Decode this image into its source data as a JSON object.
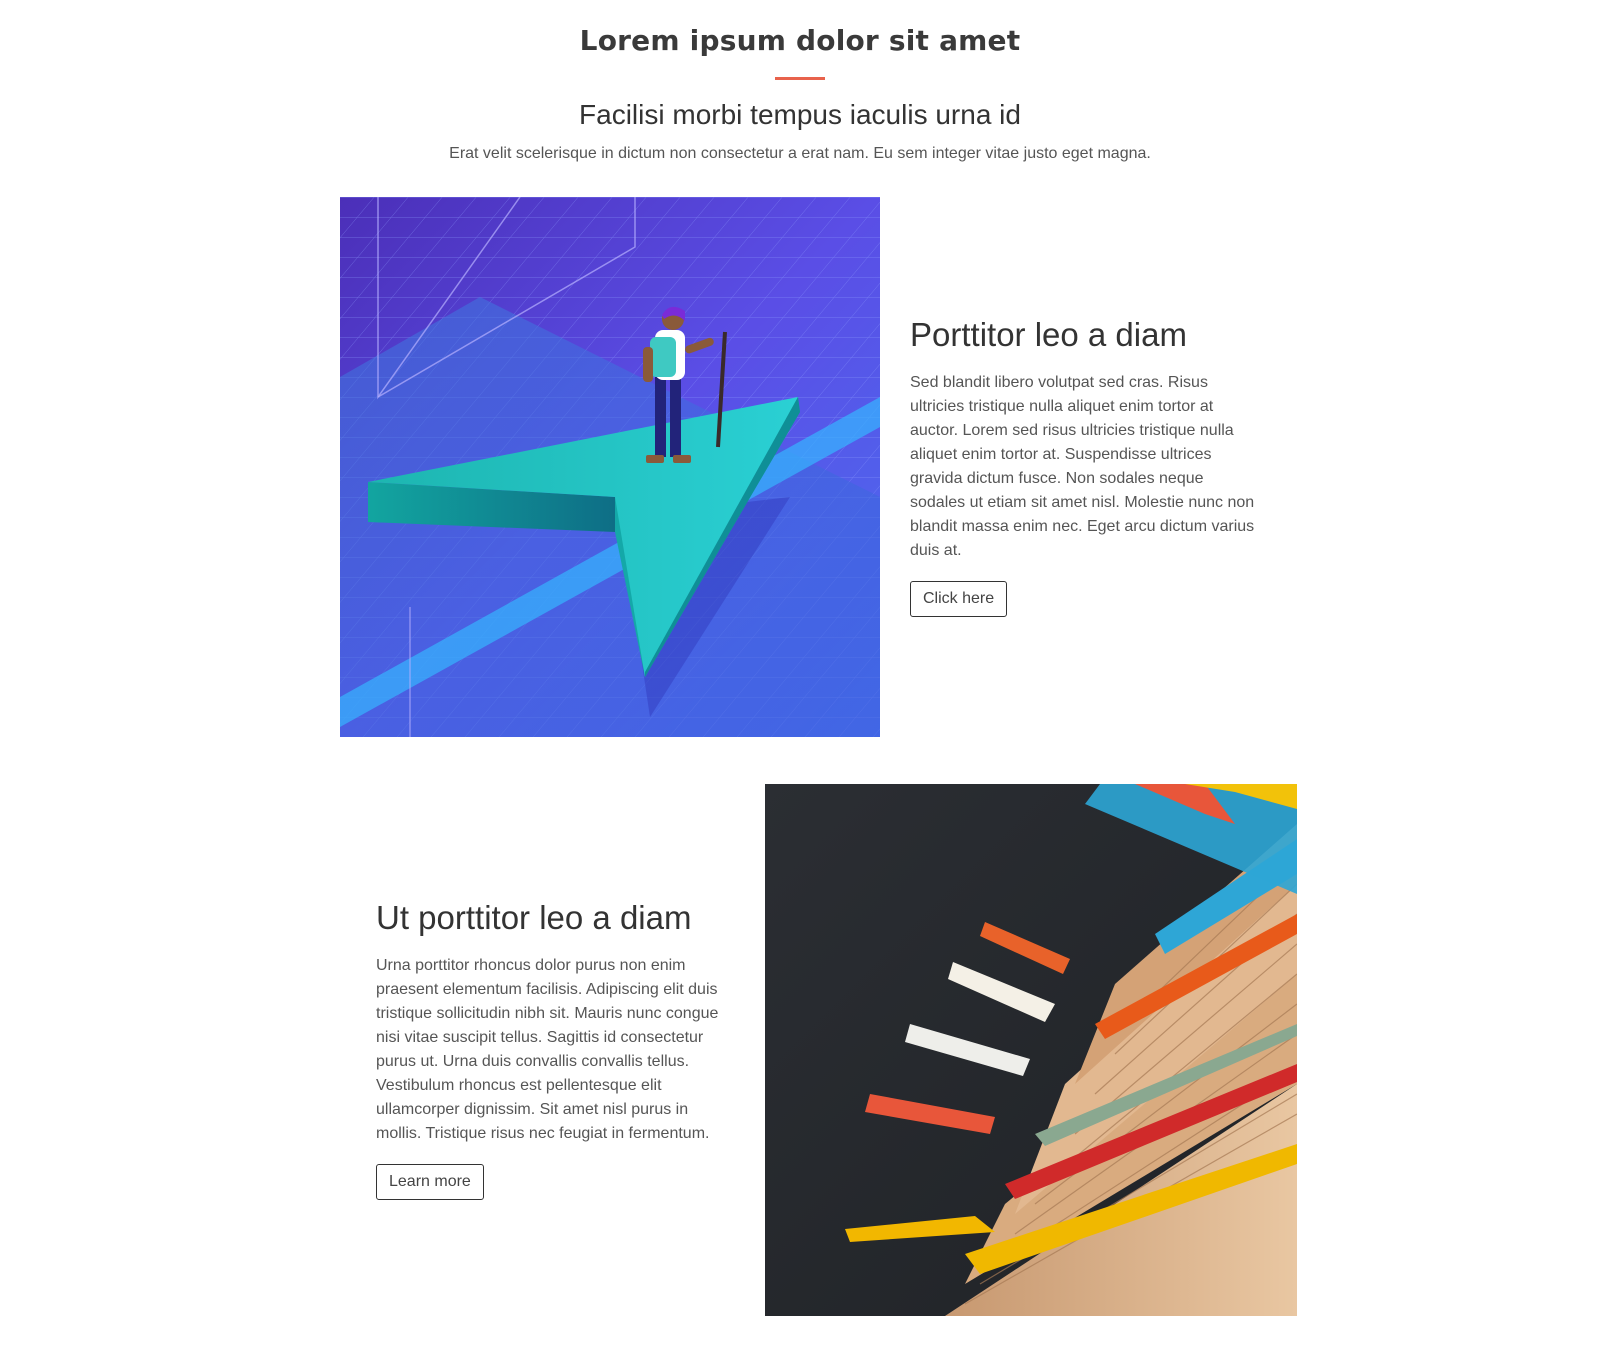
{
  "header": {
    "title": "Lorem ipsum dolor sit amet",
    "subtitle": "Facilisi morbi tempus iaculis urna id",
    "intro": "Erat velit scelerisque in dictum non consectetur a erat nam. Eu sem integer vitae justo eget magna."
  },
  "features": [
    {
      "heading": "Porttitor leo a diam",
      "body": "Sed blandit libero volutpat sed cras. Risus ultricies tristique nulla aliquet enim tortor at auctor. Lorem sed risus ultricies tristique nulla aliquet enim tortor at. Suspendisse ultrices gravida dictum fusce. Non sodales neque sodales ut etiam sit amet nisl. Molestie nunc non blandit massa enim nec. Eget arcu dictum varius duis at.",
      "button_label": "Click here",
      "image": "isometric-arrow-hiker-illustration"
    },
    {
      "heading": "Ut porttitor leo a diam",
      "body": "Urna porttitor rhoncus dolor purus non enim praesent elementum facilisis. Adipiscing elit duis tristique sollicitudin nibh sit. Mauris nunc congue nisi vitae suscipit tellus. Sagittis id consectetur purus ut. Urna duis convallis convallis tellus. Vestibulum rhoncus est pellentesque elit ullamcorper dignissim. Sit amet nisl purus in mollis. Tristique risus nec feugiat in fermentum.",
      "button_label": "Learn more",
      "image": "colorful-book-tabs-photo"
    }
  ],
  "colors": {
    "accent": "#e8624c",
    "heading": "#333333",
    "body_text": "#555555"
  }
}
